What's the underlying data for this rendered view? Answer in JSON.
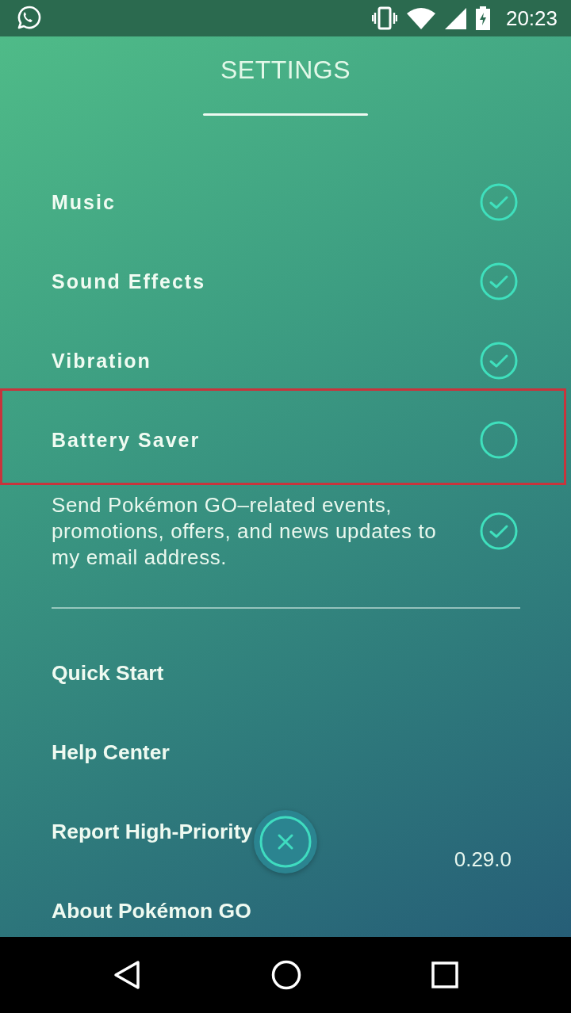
{
  "status_bar": {
    "time": "20:23"
  },
  "header": {
    "title": "SETTINGS"
  },
  "toggles": [
    {
      "kind": "option",
      "label": "Music",
      "checked": true,
      "highlighted": false
    },
    {
      "kind": "option",
      "label": "Sound Effects",
      "checked": true,
      "highlighted": false
    },
    {
      "kind": "option",
      "label": "Vibration",
      "checked": true,
      "highlighted": false
    },
    {
      "kind": "option",
      "label": "Battery Saver",
      "checked": false,
      "highlighted": true
    },
    {
      "kind": "consent",
      "label": "Send Pokémon GO–related events, promotions, offers, and news updates to my email address.",
      "checked": true,
      "highlighted": false
    }
  ],
  "links": [
    {
      "label": "Quick Start"
    },
    {
      "label": "Help Center"
    },
    {
      "label": "Report High-Priority"
    },
    {
      "label": "About Pokémon GO"
    }
  ],
  "version": "0.29.0"
}
